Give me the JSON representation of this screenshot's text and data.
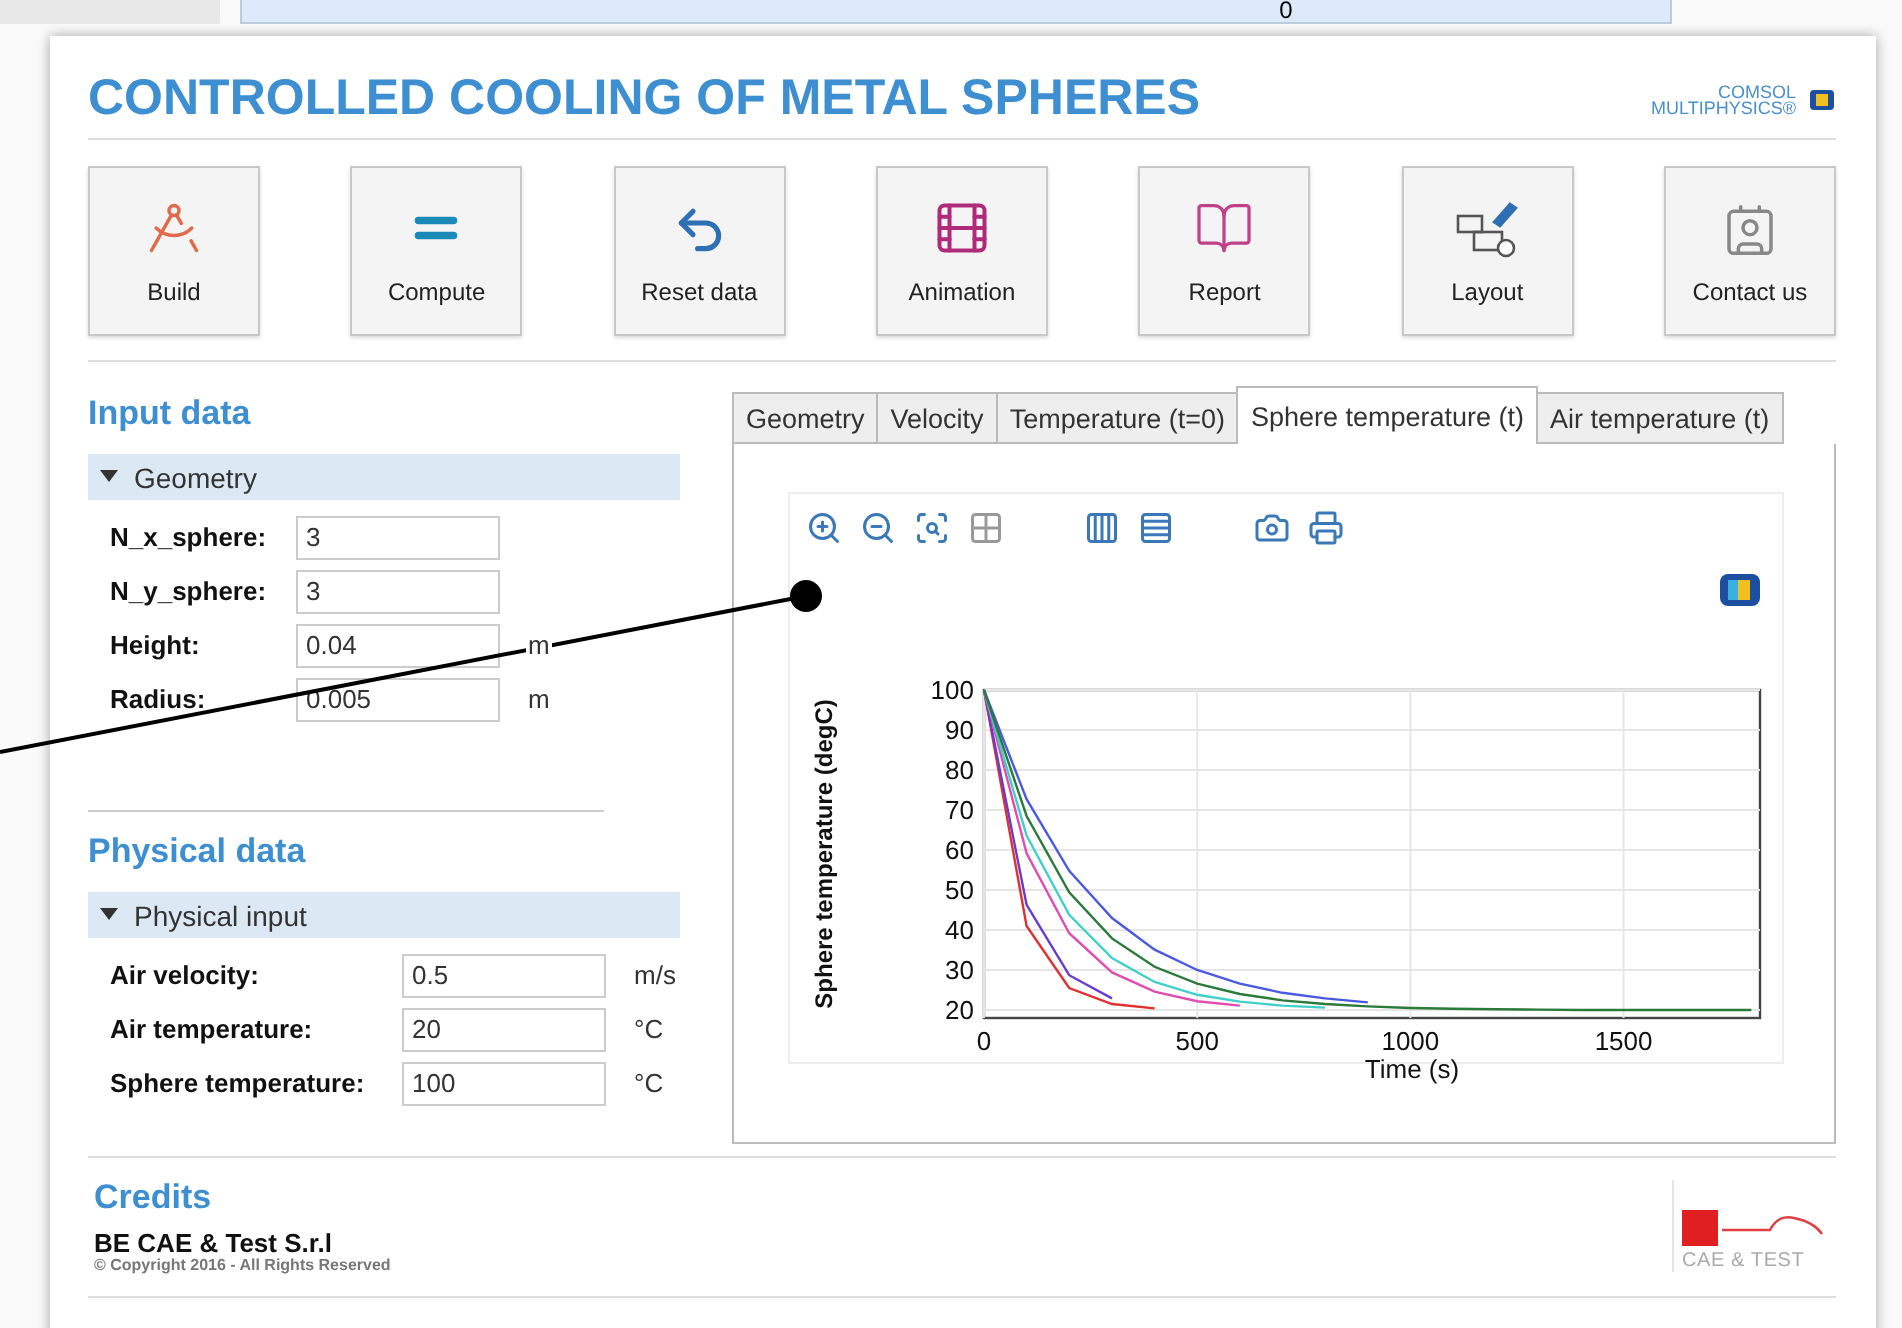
{
  "background": {
    "axis_label": "0"
  },
  "app": {
    "title": "CONTROLLED COOLING OF METAL SPHERES",
    "brand_lines": [
      "COMSOL",
      "MULTIPHYSICS®"
    ]
  },
  "toolbar": [
    {
      "label": "Build",
      "kind": "build"
    },
    {
      "label": "Compute",
      "kind": "compute"
    },
    {
      "label": "Reset data",
      "kind": "reset"
    },
    {
      "label": "Animation",
      "kind": "animation"
    },
    {
      "label": "Report",
      "kind": "report"
    },
    {
      "label": "Layout",
      "kind": "layout"
    },
    {
      "label": "Contact us",
      "kind": "contact"
    }
  ],
  "input_data": {
    "title": "Input data",
    "section": {
      "title": "Geometry",
      "expanded": true,
      "fields": [
        {
          "label": "N_x_sphere:",
          "value": "3"
        },
        {
          "label": "N_y_sphere:",
          "value": "3"
        },
        {
          "label": "Height:",
          "value": "0.04",
          "unit": "m"
        },
        {
          "label": "Radius:",
          "value": "0.005",
          "unit": "m"
        }
      ]
    }
  },
  "physical_data": {
    "title": "Physical data",
    "section": {
      "title": "Physical input",
      "expanded": true,
      "fields": [
        {
          "label": "Air velocity:",
          "value": "0.5",
          "unit": "m/s"
        },
        {
          "label": "Air temperature:",
          "value": "20",
          "unit": "°C"
        },
        {
          "label": "Sphere temperature:",
          "value": "100",
          "unit": "°C"
        }
      ]
    }
  },
  "tabs": [
    {
      "label": "Geometry",
      "selected": false
    },
    {
      "label": "Velocity",
      "selected": false
    },
    {
      "label": "Temperature (t=0)",
      "selected": false
    },
    {
      "label": "Sphere temperature (t)",
      "selected": true
    },
    {
      "label": "Air temperature (t)",
      "selected": false
    }
  ],
  "plot": {
    "chart_data": {
      "type": "line",
      "xlabel": "Time (s)",
      "ylabel": "Sphere temperature (degC)",
      "x": [
        0,
        100,
        200,
        300,
        400,
        500,
        600,
        700,
        800,
        900,
        1000,
        1100,
        1200,
        1300,
        1400,
        1500,
        1600,
        1700,
        1800
      ],
      "series": [
        {
          "color": "#e03030",
          "values": [
            100,
            41,
            25.5,
            21.5,
            20.4,
            null,
            null,
            null,
            null,
            null,
            null,
            null,
            null,
            null,
            null,
            null,
            null,
            null,
            null
          ]
        },
        {
          "color": "#6a3bd0",
          "values": [
            100,
            46.3,
            28.7,
            22.9,
            null,
            null,
            null,
            null,
            null,
            null,
            null,
            null,
            null,
            null,
            null,
            null,
            null,
            null,
            null
          ]
        },
        {
          "color": "#e04cb0",
          "values": [
            100,
            59.2,
            39.2,
            29.4,
            24.6,
            22.2,
            21.1,
            null,
            null,
            null,
            null,
            null,
            null,
            null,
            null,
            null,
            null,
            null,
            null
          ]
        },
        {
          "color": "#40d0c8",
          "values": [
            100,
            63.6,
            43.8,
            33,
            27,
            23.8,
            22.1,
            21.1,
            20.6,
            null,
            null,
            null,
            null,
            null,
            null,
            null,
            null,
            null,
            null
          ]
        },
        {
          "color": "#4a5ae0",
          "values": [
            100,
            72.7,
            54.8,
            43,
            35.1,
            30,
            26.6,
            24.3,
            22.9,
            21.9,
            null,
            null,
            null,
            null,
            null,
            null,
            null,
            null,
            null
          ]
        },
        {
          "color": "#2a7a3a",
          "values": [
            100,
            68.5,
            49.4,
            37.9,
            30.8,
            26.6,
            24,
            22.4,
            21.5,
            20.9,
            20.5,
            20.3,
            20.2,
            20.1,
            20,
            20,
            20,
            20,
            20
          ]
        }
      ],
      "grid": true,
      "xlim": [
        0,
        1820
      ],
      "ylim": [
        18,
        100
      ],
      "xticks": [
        0,
        500,
        1000,
        1500
      ],
      "yticks": [
        20,
        30,
        40,
        50,
        60,
        70,
        80,
        90,
        100
      ]
    }
  },
  "credits": {
    "title": "Credits",
    "company": "BE CAE & Test S.r.l",
    "copyright": "© Copyright 2016 - All Rights Reserved",
    "logo_text": "CAE & TEST"
  }
}
